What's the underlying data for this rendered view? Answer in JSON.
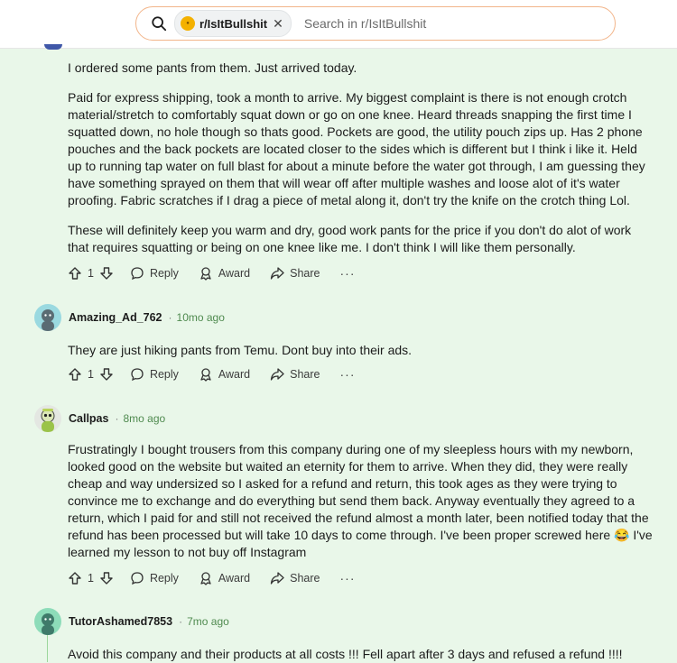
{
  "search": {
    "community": "r/IsItBullshit",
    "placeholder": "Search in r/IsItBullshit"
  },
  "action_labels": {
    "reply": "Reply",
    "award": "Award",
    "share": "Share",
    "more": "···"
  },
  "comments": [
    {
      "paragraphs": [
        "I ordered some pants from them. Just arrived today.",
        "Paid for express shipping, took a month to arrive. My biggest complaint is there is not enough crotch material/stretch to comfortably squat down or go on one knee. Heard threads snapping the first time I squatted down, no hole though so thats good. Pockets are good, the utility pouch zips up. Has 2 phone pouches and the back pockets are located closer to the sides which is different but I think i like it. Held up to running tap water on full blast for about a minute before the water got through, I am guessing they have something sprayed on them that will wear off after multiple washes and loose alot of it's water proofing. Fabric scratches if I drag a piece of metal along it, don't try the knife on the crotch thing Lol.",
        "These will definitely keep you warm and dry, good work pants for the price if you don't do alot of work that requires squatting or being on one knee like me. I don't think I will like them personally."
      ],
      "votes": "1"
    },
    {
      "username": "Amazing_Ad_762",
      "time": "10mo ago",
      "paragraphs": [
        "They are just hiking pants from Temu. Dont buy into their ads."
      ],
      "votes": "1"
    },
    {
      "username": "Callpas",
      "time": "8mo ago",
      "paragraphs": [
        "Frustratingly I bought trousers from this company during one of my sleepless hours with my newborn, looked good on the website but waited an eternity for them to arrive. When they did, they were really cheap and way undersized so I asked for a refund and return, this took ages as they were trying to convince me to exchange and do everything but send them back. Anyway eventually they agreed to a return, which I paid for and still not received the refund almost a month later, been notified today that the refund has been processed but will take 10 days to come through. I've been proper screwed here 😂 I've learned my lesson to not buy off Instagram"
      ],
      "votes": "1"
    },
    {
      "username": "TutorAshamed7853",
      "time": "7mo ago",
      "paragraphs": [
        "Avoid this company and their products at all costs !!! Fell apart after 3 days and refused a refund !!!!"
      ]
    }
  ],
  "colors": {
    "page_bg": "#e9f7e9",
    "accent_green": "#4f8a4f",
    "search_border": "#f2b58a"
  },
  "icons": [
    "search-icon",
    "subreddit-icon",
    "close-icon",
    "upvote-icon",
    "downvote-icon",
    "reply-icon",
    "award-icon",
    "share-icon",
    "more-icon",
    "snoo-avatar-icon"
  ]
}
